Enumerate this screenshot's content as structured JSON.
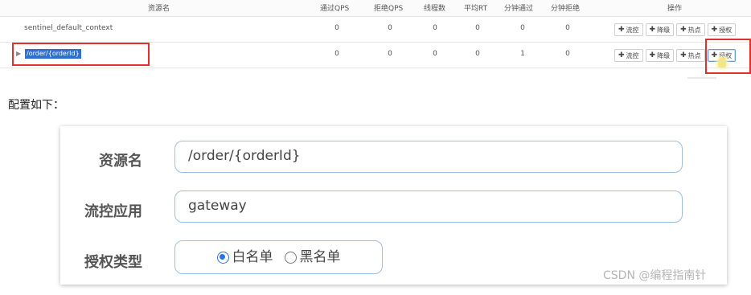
{
  "table": {
    "headers": [
      "资源名",
      "通过QPS",
      "拒绝QPS",
      "线程数",
      "平均RT",
      "分钟通过",
      "分钟拒绝",
      "操作"
    ],
    "rows": [
      {
        "resource": "sentinel_default_context",
        "values": [
          "0",
          "0",
          "0",
          "0",
          "0",
          "0"
        ],
        "expandable": false,
        "selected": false
      },
      {
        "resource": "/order/{orderId}",
        "values": [
          "0",
          "0",
          "0",
          "0",
          "1",
          "0"
        ],
        "expandable": true,
        "selected": true
      }
    ],
    "actions": [
      "流控",
      "降级",
      "热点",
      "授权"
    ],
    "action_plus": "✚"
  },
  "caption": "配置如下：",
  "form": {
    "resource_label": "资源名",
    "resource_value": "/order/{orderId}",
    "app_label": "流控应用",
    "app_value": "gateway",
    "auth_label": "授权类型",
    "options": [
      "白名单",
      "黑名单"
    ],
    "selected_option": "白名单"
  },
  "watermark": "CSDN @编程指南针",
  "colors": {
    "highlight": "#e0312f",
    "selection": "#2f6fd1",
    "field_border": "#9fbfdf",
    "radio_selected": "#2a75d6"
  }
}
